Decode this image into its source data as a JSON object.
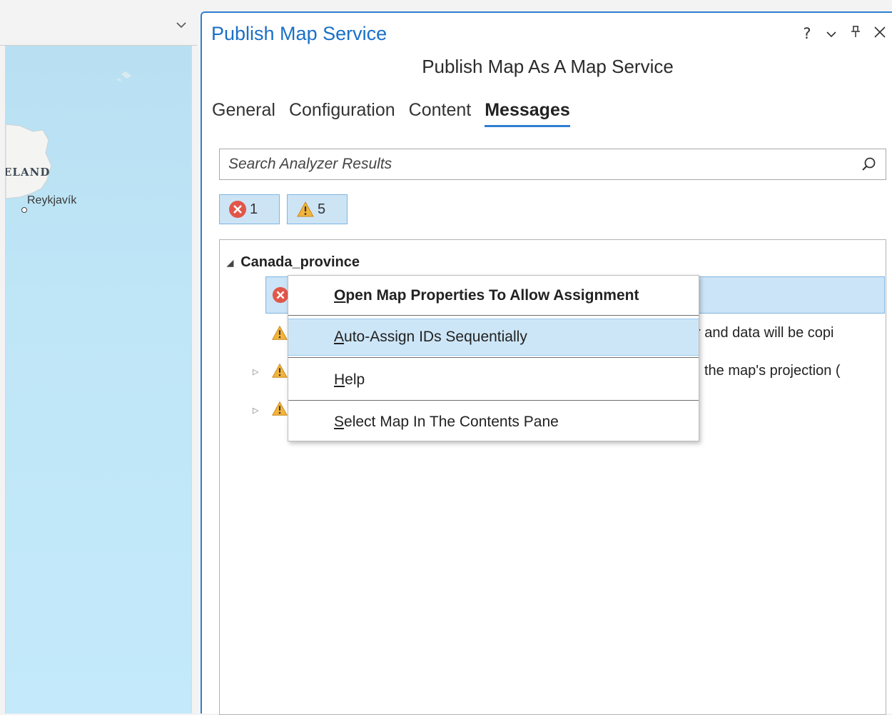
{
  "map": {
    "country_label": "ELAND",
    "city_label": "Reykjavík"
  },
  "pane": {
    "title": "Publish Map Service",
    "controls": {
      "help": "?",
      "dropdown": "⌄",
      "pin": "⊥",
      "close": "✕"
    },
    "subtitle": "Publish Map As A Map Service",
    "tabs": [
      {
        "label": "General"
      },
      {
        "label": "Configuration"
      },
      {
        "label": "Content"
      },
      {
        "label": "Messages"
      }
    ],
    "search": {
      "placeholder": "Search Analyzer Results"
    },
    "filters": {
      "errors": "1",
      "warnings": "5"
    },
    "tree": {
      "root": "Canada_province",
      "rows": [
        {
          "kind": "error",
          "text": ""
        },
        {
          "kind": "warning",
          "text": "r and data will be copi"
        },
        {
          "kind": "warning",
          "text": "the map's projection ("
        },
        {
          "kind": "warning",
          "text": ""
        }
      ]
    }
  },
  "context_menu": {
    "items": [
      {
        "label_pre": "",
        "label_ul": "O",
        "label_post": "pen Map Properties To Allow Assignment"
      },
      {
        "label_pre": "",
        "label_ul": "A",
        "label_post": "uto-Assign IDs Sequentially"
      },
      {
        "label_pre": "",
        "label_ul": "H",
        "label_post": "elp"
      },
      {
        "label_pre": "",
        "label_ul": "S",
        "label_post": "elect Map In The Contents Pane"
      }
    ]
  },
  "colors": {
    "accent": "#2f7fd3",
    "selection": "#cce4f7",
    "error": "#e2564a",
    "warning": "#f2b43c"
  }
}
